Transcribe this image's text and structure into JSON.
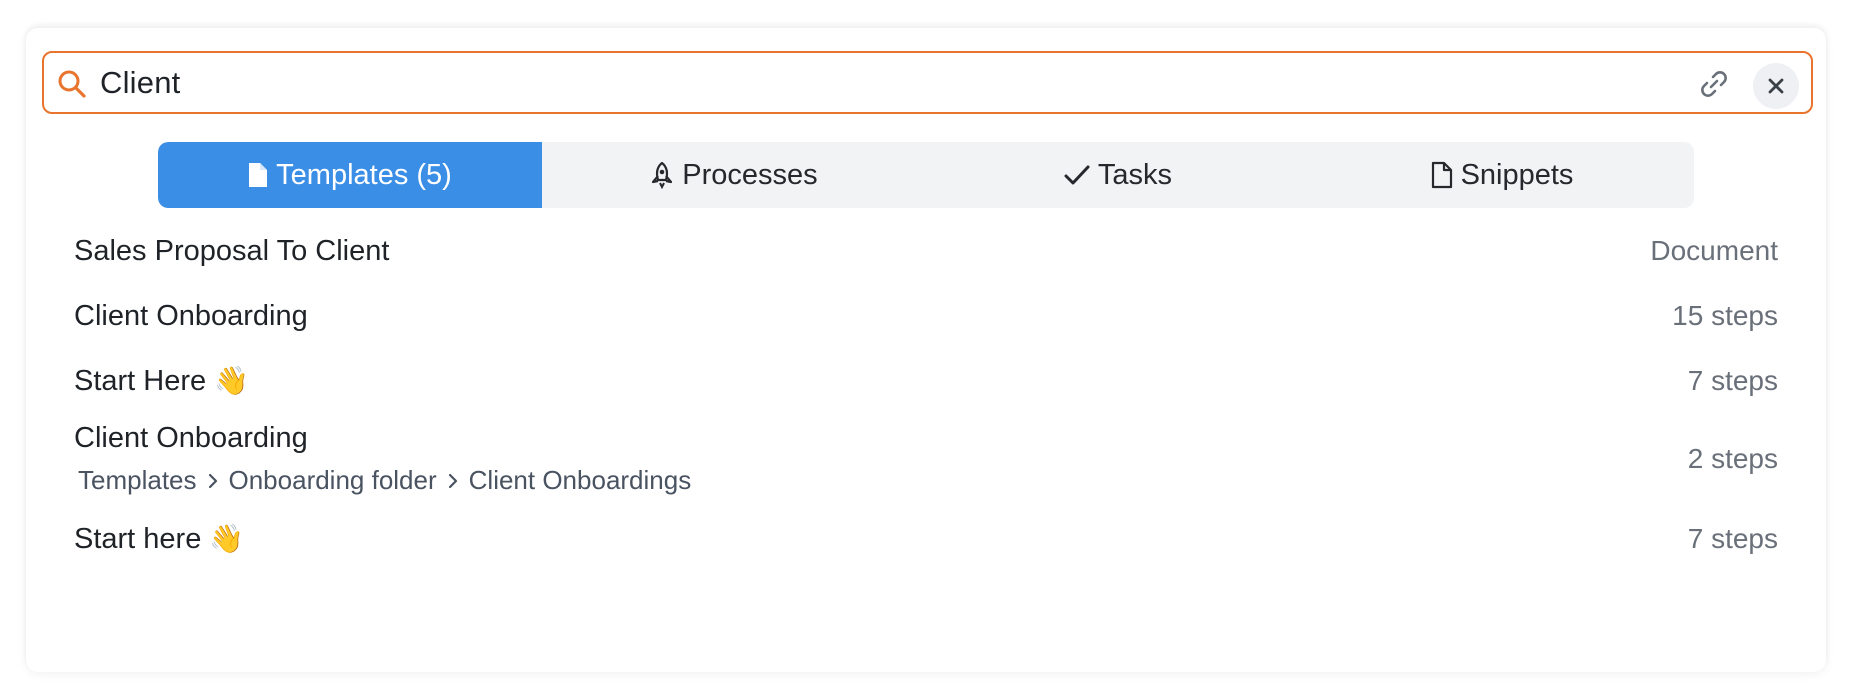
{
  "search": {
    "query": "Client",
    "icon": "search-icon",
    "accent_color": "#e8742e",
    "link_icon": "link-icon",
    "clear_icon": "close-icon"
  },
  "tabs": [
    {
      "label": "Templates (5)",
      "icon": "document-filled-icon",
      "active": true
    },
    {
      "label": "Processes",
      "icon": "rocket-icon",
      "active": false
    },
    {
      "label": "Tasks",
      "icon": "checkmark-icon",
      "active": false
    },
    {
      "label": "Snippets",
      "icon": "document-outline-icon",
      "active": false
    }
  ],
  "active_tab_color": "#3a8ee6",
  "results": [
    {
      "title": "Sales Proposal To Client",
      "emoji": "",
      "meta": "Document"
    },
    {
      "title": "Client Onboarding",
      "emoji": "",
      "meta": "15 steps"
    },
    {
      "title": "Start Here",
      "emoji": "👋",
      "meta": "7 steps"
    },
    {
      "title": "Client Onboarding",
      "emoji": "",
      "meta": "2 steps",
      "breadcrumb": [
        "Templates",
        "Onboarding folder",
        "Client Onboardings"
      ]
    },
    {
      "title": "Start here",
      "emoji": "👋",
      "meta": "7 steps"
    }
  ]
}
